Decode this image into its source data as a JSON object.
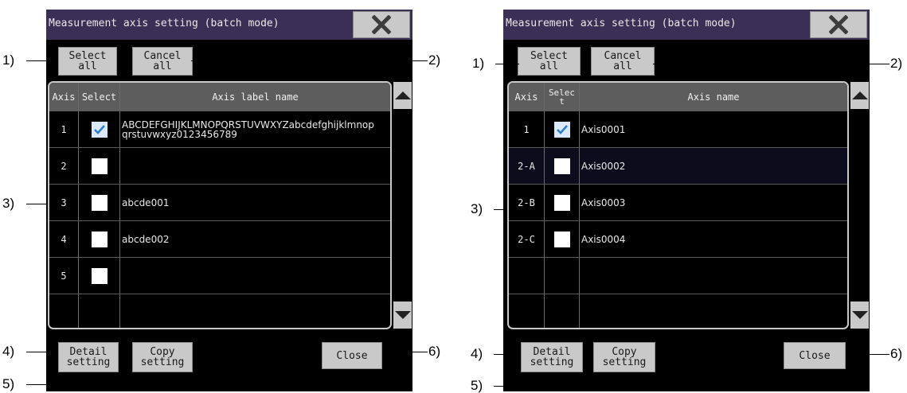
{
  "callouts": [
    "1)",
    "2)",
    "3)",
    "4)",
    "5)",
    "6)"
  ],
  "left": {
    "title": "Measurement axis setting (batch mode)",
    "close_icon": "close-x-icon",
    "select_all": "Select all",
    "cancel_all": "Cancel all",
    "columns": [
      "Axis",
      "Select",
      "Axis label name"
    ],
    "rows": [
      {
        "axis": "1",
        "checked": true,
        "name": "ABCDEFGHIJKLMNOPQRSTUVWXYZabcdefghijklmnop qrstuvwxyz0123456789"
      },
      {
        "axis": "2",
        "checked": false,
        "name": ""
      },
      {
        "axis": "3",
        "checked": false,
        "name": "abcde001"
      },
      {
        "axis": "4",
        "checked": false,
        "name": "abcde002"
      },
      {
        "axis": "5",
        "checked": false,
        "name": ""
      },
      {
        "axis": "",
        "checked": null,
        "name": ""
      }
    ],
    "detail_setting": "Detail\nsetting",
    "copy_setting": "Copy\nsetting",
    "close": "Close"
  },
  "right": {
    "title": "Measurement axis setting (batch mode)",
    "close_icon": "close-x-icon",
    "select_all": "Select all",
    "cancel_all": "Cancel all",
    "columns": [
      "Axis",
      "Selec\nt",
      "Axis name"
    ],
    "rows": [
      {
        "axis": "1",
        "checked": true,
        "name": "Axis0001"
      },
      {
        "axis": "2-A",
        "checked": false,
        "name": "Axis0002"
      },
      {
        "axis": "2-B",
        "checked": false,
        "name": "Axis0003"
      },
      {
        "axis": "2-C",
        "checked": false,
        "name": "Axis0004"
      },
      {
        "axis": "",
        "checked": null,
        "name": ""
      },
      {
        "axis": "",
        "checked": null,
        "name": ""
      }
    ],
    "detail_setting": "Detail\nsetting",
    "copy_setting": "Copy\nsetting",
    "close": "Close"
  },
  "colors": {
    "title_bar": "#3a2f55",
    "button": "#c9c9c9",
    "header": "#5d5d5d",
    "check": "#2a7fd4"
  }
}
